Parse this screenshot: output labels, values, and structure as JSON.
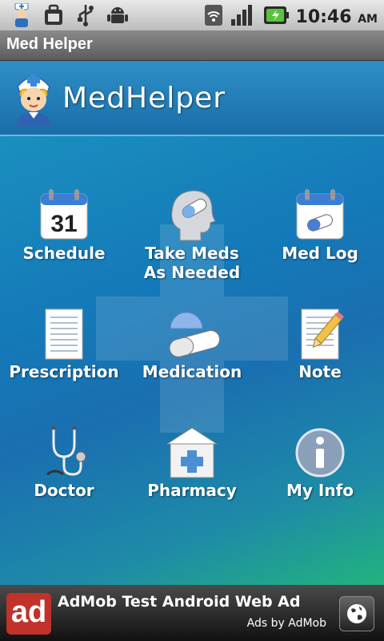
{
  "status_bar": {
    "time": "10:46",
    "ampm": "AM",
    "icons": [
      "nurse-notification-icon",
      "briefcase-icon",
      "usb-icon",
      "android-debug-icon"
    ],
    "right_icons": [
      "wifi-icon",
      "signal-icon",
      "battery-charging-icon"
    ]
  },
  "app": {
    "title": "Med Helper"
  },
  "header": {
    "logo_text": "MedHelper"
  },
  "menu": [
    {
      "label": "Schedule",
      "icon": "calendar-icon",
      "calendar_day": "31"
    },
    {
      "label": "Take Meds\nAs Needed",
      "line1": "Take Meds",
      "line2": "As Needed",
      "icon": "head-pill-icon"
    },
    {
      "label": "Med Log",
      "icon": "calendar-pill-icon"
    },
    {
      "label": "Prescription",
      "icon": "prescription-paper-icon"
    },
    {
      "label": "Medication",
      "icon": "capsule-icon"
    },
    {
      "label": "Note",
      "icon": "note-pencil-icon"
    },
    {
      "label": "Doctor",
      "icon": "stethoscope-icon"
    },
    {
      "label": "Pharmacy",
      "icon": "pharmacy-building-icon"
    },
    {
      "label": "My Info",
      "icon": "info-icon"
    }
  ],
  "ad": {
    "logo": "ad",
    "title": "AdMob Test Android Web Ad",
    "subtitle": "Ads by AdMob"
  },
  "colors": {
    "header_blue": "#1f7ab5",
    "ad_red": "#c0322a",
    "main_gradient_start": "#1a8fbf",
    "main_gradient_end": "#22b37e"
  }
}
